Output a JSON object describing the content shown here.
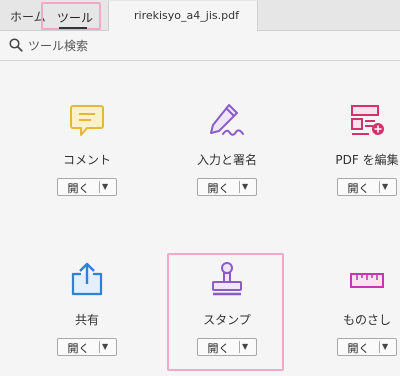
{
  "tabs": {
    "home": "ホーム",
    "tools": "ツール",
    "document": "rirekisyo_a4_jis.pdf"
  },
  "search": {
    "placeholder": "ツール検索"
  },
  "open_label": "開く",
  "tools": [
    {
      "label": "コメント",
      "icon": "comment-icon"
    },
    {
      "label": "入力と署名",
      "icon": "fill-sign-icon"
    },
    {
      "label": "PDF を編集",
      "icon": "edit-pdf-icon"
    },
    {
      "label": "共有",
      "icon": "share-icon"
    },
    {
      "label": "スタンプ",
      "icon": "stamp-icon"
    },
    {
      "label": "ものさし",
      "icon": "ruler-icon"
    }
  ],
  "colors": {
    "highlight": "#f2a9c8",
    "comment": "#e5b73b",
    "fill_sign": "#8b5cc9",
    "edit_pdf": "#d4326e",
    "share": "#2f80d9",
    "stamp": "#8b5cc9",
    "ruler": "#c03aad"
  }
}
